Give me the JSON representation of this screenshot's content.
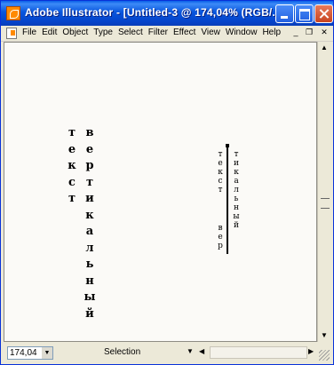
{
  "titlebar": {
    "title": "Adobe Illustrator - [Untitled-3 @ 174,04% (RGB/..."
  },
  "menu": {
    "items": [
      "File",
      "Edit",
      "Object",
      "Type",
      "Select",
      "Filter",
      "Effect",
      "View",
      "Window",
      "Help"
    ]
  },
  "canvas": {
    "large_text": {
      "col1": [
        "т",
        "е",
        "к",
        "с",
        "т"
      ],
      "col2": [
        "в",
        "е",
        "р",
        "т",
        "и",
        "к",
        "а",
        "л",
        "ь",
        "н",
        "ы",
        "й"
      ]
    },
    "small_text": {
      "col1": [
        "т",
        "е",
        "к",
        "с",
        "т"
      ],
      "col2": [
        "в",
        "е",
        "р"
      ],
      "col3": [
        "т",
        "и",
        "к",
        "а",
        "л",
        "ь",
        "н",
        "ы",
        "й"
      ]
    }
  },
  "status": {
    "zoom": "174,04",
    "tool": "Selection"
  },
  "colors": {
    "titlebar": "#0855dd",
    "canvas": "#fbfaf7",
    "chrome": "#ece9d8"
  }
}
